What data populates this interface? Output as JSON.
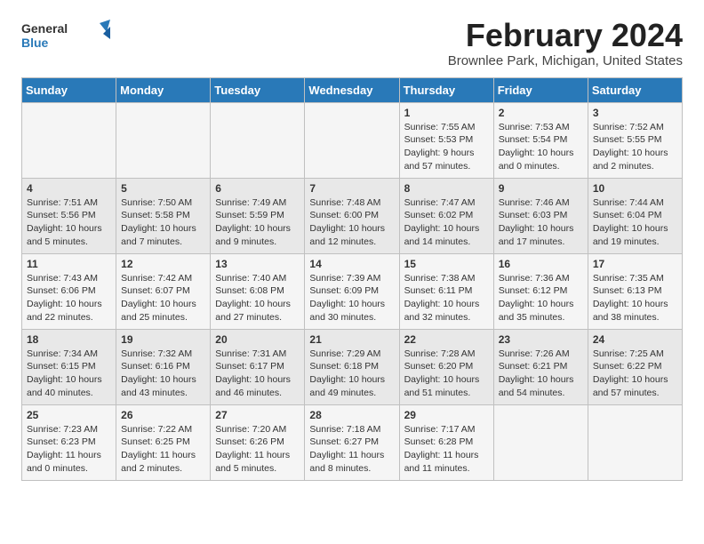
{
  "logo": {
    "line1": "General",
    "line2": "Blue"
  },
  "title": "February 2024",
  "subtitle": "Brownlee Park, Michigan, United States",
  "days_of_week": [
    "Sunday",
    "Monday",
    "Tuesday",
    "Wednesday",
    "Thursday",
    "Friday",
    "Saturday"
  ],
  "weeks": [
    [
      {
        "day": "",
        "info": ""
      },
      {
        "day": "",
        "info": ""
      },
      {
        "day": "",
        "info": ""
      },
      {
        "day": "",
        "info": ""
      },
      {
        "day": "1",
        "info": "Sunrise: 7:55 AM\nSunset: 5:53 PM\nDaylight: 9 hours\nand 57 minutes."
      },
      {
        "day": "2",
        "info": "Sunrise: 7:53 AM\nSunset: 5:54 PM\nDaylight: 10 hours\nand 0 minutes."
      },
      {
        "day": "3",
        "info": "Sunrise: 7:52 AM\nSunset: 5:55 PM\nDaylight: 10 hours\nand 2 minutes."
      }
    ],
    [
      {
        "day": "4",
        "info": "Sunrise: 7:51 AM\nSunset: 5:56 PM\nDaylight: 10 hours\nand 5 minutes."
      },
      {
        "day": "5",
        "info": "Sunrise: 7:50 AM\nSunset: 5:58 PM\nDaylight: 10 hours\nand 7 minutes."
      },
      {
        "day": "6",
        "info": "Sunrise: 7:49 AM\nSunset: 5:59 PM\nDaylight: 10 hours\nand 9 minutes."
      },
      {
        "day": "7",
        "info": "Sunrise: 7:48 AM\nSunset: 6:00 PM\nDaylight: 10 hours\nand 12 minutes."
      },
      {
        "day": "8",
        "info": "Sunrise: 7:47 AM\nSunset: 6:02 PM\nDaylight: 10 hours\nand 14 minutes."
      },
      {
        "day": "9",
        "info": "Sunrise: 7:46 AM\nSunset: 6:03 PM\nDaylight: 10 hours\nand 17 minutes."
      },
      {
        "day": "10",
        "info": "Sunrise: 7:44 AM\nSunset: 6:04 PM\nDaylight: 10 hours\nand 19 minutes."
      }
    ],
    [
      {
        "day": "11",
        "info": "Sunrise: 7:43 AM\nSunset: 6:06 PM\nDaylight: 10 hours\nand 22 minutes."
      },
      {
        "day": "12",
        "info": "Sunrise: 7:42 AM\nSunset: 6:07 PM\nDaylight: 10 hours\nand 25 minutes."
      },
      {
        "day": "13",
        "info": "Sunrise: 7:40 AM\nSunset: 6:08 PM\nDaylight: 10 hours\nand 27 minutes."
      },
      {
        "day": "14",
        "info": "Sunrise: 7:39 AM\nSunset: 6:09 PM\nDaylight: 10 hours\nand 30 minutes."
      },
      {
        "day": "15",
        "info": "Sunrise: 7:38 AM\nSunset: 6:11 PM\nDaylight: 10 hours\nand 32 minutes."
      },
      {
        "day": "16",
        "info": "Sunrise: 7:36 AM\nSunset: 6:12 PM\nDaylight: 10 hours\nand 35 minutes."
      },
      {
        "day": "17",
        "info": "Sunrise: 7:35 AM\nSunset: 6:13 PM\nDaylight: 10 hours\nand 38 minutes."
      }
    ],
    [
      {
        "day": "18",
        "info": "Sunrise: 7:34 AM\nSunset: 6:15 PM\nDaylight: 10 hours\nand 40 minutes."
      },
      {
        "day": "19",
        "info": "Sunrise: 7:32 AM\nSunset: 6:16 PM\nDaylight: 10 hours\nand 43 minutes."
      },
      {
        "day": "20",
        "info": "Sunrise: 7:31 AM\nSunset: 6:17 PM\nDaylight: 10 hours\nand 46 minutes."
      },
      {
        "day": "21",
        "info": "Sunrise: 7:29 AM\nSunset: 6:18 PM\nDaylight: 10 hours\nand 49 minutes."
      },
      {
        "day": "22",
        "info": "Sunrise: 7:28 AM\nSunset: 6:20 PM\nDaylight: 10 hours\nand 51 minutes."
      },
      {
        "day": "23",
        "info": "Sunrise: 7:26 AM\nSunset: 6:21 PM\nDaylight: 10 hours\nand 54 minutes."
      },
      {
        "day": "24",
        "info": "Sunrise: 7:25 AM\nSunset: 6:22 PM\nDaylight: 10 hours\nand 57 minutes."
      }
    ],
    [
      {
        "day": "25",
        "info": "Sunrise: 7:23 AM\nSunset: 6:23 PM\nDaylight: 11 hours\nand 0 minutes."
      },
      {
        "day": "26",
        "info": "Sunrise: 7:22 AM\nSunset: 6:25 PM\nDaylight: 11 hours\nand 2 minutes."
      },
      {
        "day": "27",
        "info": "Sunrise: 7:20 AM\nSunset: 6:26 PM\nDaylight: 11 hours\nand 5 minutes."
      },
      {
        "day": "28",
        "info": "Sunrise: 7:18 AM\nSunset: 6:27 PM\nDaylight: 11 hours\nand 8 minutes."
      },
      {
        "day": "29",
        "info": "Sunrise: 7:17 AM\nSunset: 6:28 PM\nDaylight: 11 hours\nand 11 minutes."
      },
      {
        "day": "",
        "info": ""
      },
      {
        "day": "",
        "info": ""
      }
    ]
  ]
}
